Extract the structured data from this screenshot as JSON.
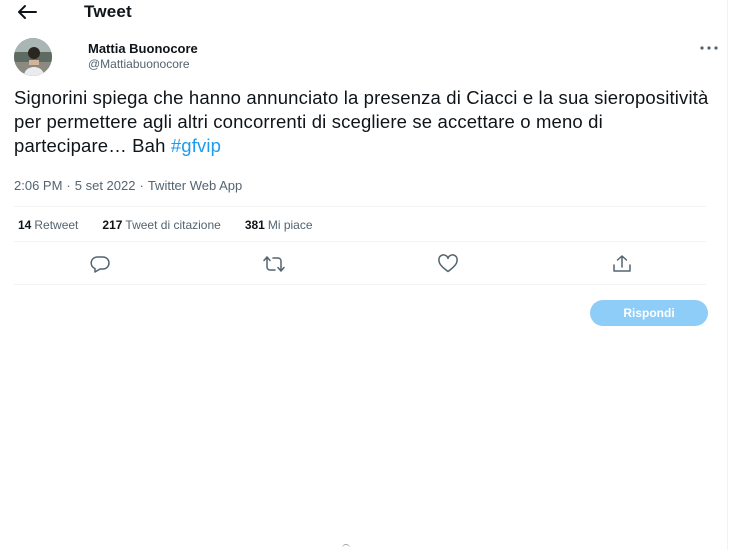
{
  "header": {
    "title": "Tweet"
  },
  "author": {
    "name": "Mattia Buonocore",
    "handle": "@Mattiabuonocore"
  },
  "tweet": {
    "text": "Signorini spiega che hanno annunciato la presenza di Ciacci e la sua sieropositività per permettere agli altri concorrenti di scegliere se accettare o meno di partecipare… Bah ",
    "hashtag": "#gfvip",
    "time": "2:06 PM",
    "date": "5 set 2022",
    "source": "Twitter Web App",
    "separator": "·"
  },
  "stats": {
    "retweets_count": "14",
    "retweets_label": "Retweet",
    "quotes_count": "217",
    "quotes_label": "Tweet di citazione",
    "likes_count": "381",
    "likes_label": "Mi piace"
  },
  "reply": {
    "button_label": "Rispondi"
  },
  "icons": {
    "back": "arrow-left-icon",
    "more": "more-horizontal-icon",
    "reply": "comment-icon",
    "retweet": "retweet-icon",
    "like": "heart-icon",
    "share": "share-icon"
  },
  "colors": {
    "accent": "#1d9bf0",
    "reply_button": "#8ecdf8",
    "secondary_text": "#536471",
    "primary_text": "#0f1419"
  }
}
